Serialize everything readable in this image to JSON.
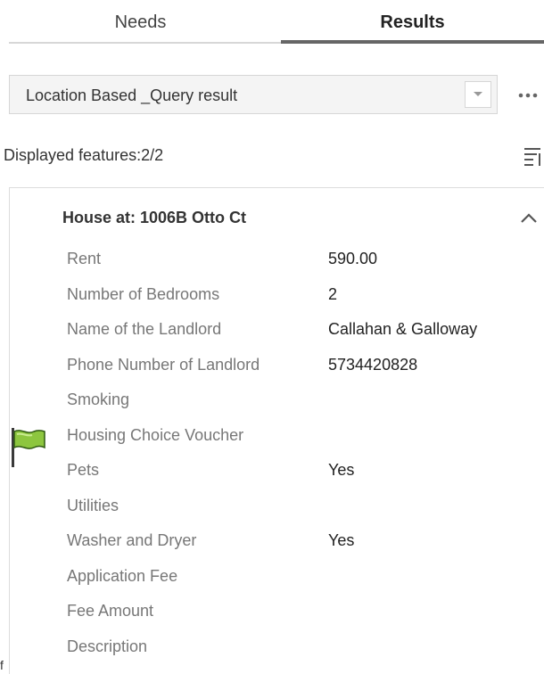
{
  "tabs": [
    {
      "label": "Needs"
    },
    {
      "label": "Results"
    }
  ],
  "query": {
    "selected": "Location Based _Query result"
  },
  "results": {
    "displayed_text": "Displayed features:2/2"
  },
  "feature": {
    "title": "House at: 1006B Otto Ct",
    "attributes": [
      {
        "key": "Rent",
        "value": "590.00"
      },
      {
        "key": "Number of Bedrooms",
        "value": "2"
      },
      {
        "key": "Name of the Landlord",
        "value": "Callahan & Galloway"
      },
      {
        "key": "Phone Number of Landlord",
        "value": "5734420828"
      },
      {
        "key": "Smoking",
        "value": ""
      },
      {
        "key": "Housing Choice Voucher",
        "value": ""
      },
      {
        "key": "Pets",
        "value": "Yes"
      },
      {
        "key": "Utilities",
        "value": ""
      },
      {
        "key": "Washer and Dryer",
        "value": "Yes"
      },
      {
        "key": "Application Fee",
        "value": ""
      },
      {
        "key": "Fee Amount",
        "value": ""
      },
      {
        "key": "Description",
        "value": ""
      }
    ]
  },
  "footer": {
    "fragment": "f"
  },
  "icons": {
    "dropdown": "chevron-down-icon",
    "more": "more-horizontal-icon",
    "list": "list-sort-icon",
    "collapse": "chevron-up-icon",
    "flag": "flag-icon"
  },
  "colors": {
    "flag_green": "#8dc63f",
    "active_tab_bar": "#666666"
  }
}
